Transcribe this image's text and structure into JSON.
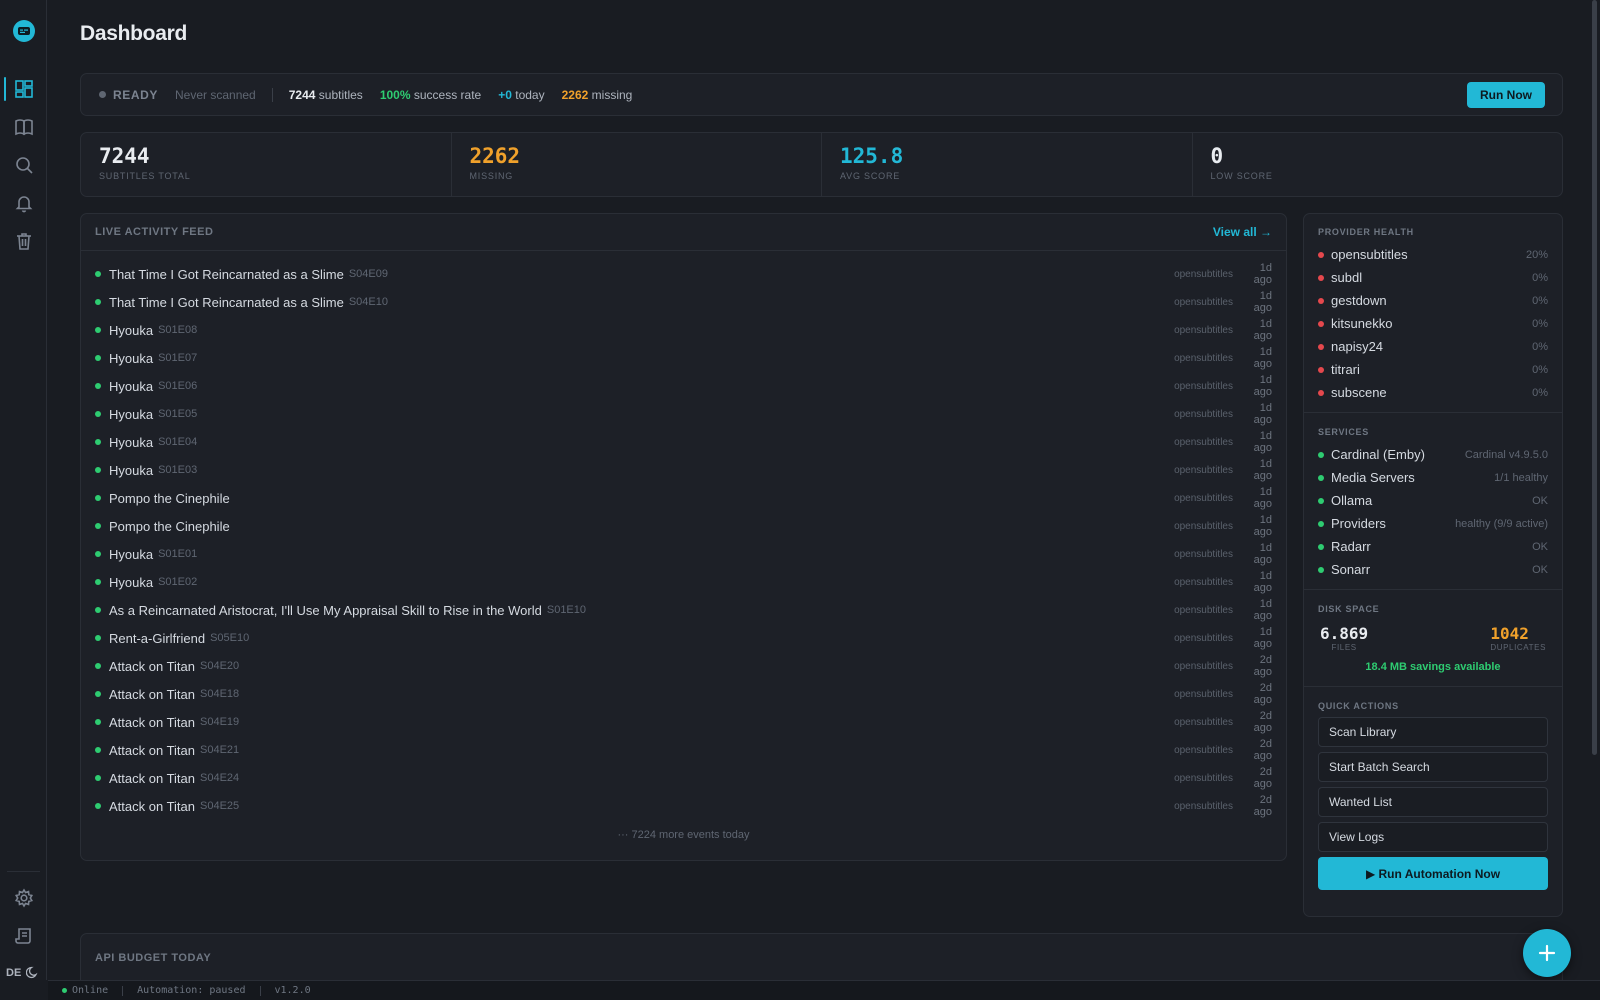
{
  "page": {
    "title": "Dashboard"
  },
  "colors": {
    "accent": "#22b8d6",
    "success": "#2ecc71",
    "warning": "#f0a12b",
    "danger": "#e5484d"
  },
  "sidebar": {
    "items": [
      {
        "icon": "dashboard-icon",
        "active": true
      },
      {
        "icon": "library-icon"
      },
      {
        "icon": "search-icon"
      },
      {
        "icon": "bell-icon"
      },
      {
        "icon": "trash-icon"
      }
    ],
    "bottom": [
      {
        "icon": "gear-icon"
      },
      {
        "icon": "logs-icon"
      }
    ],
    "language": "DE",
    "theme_icon": "moon-icon"
  },
  "status": {
    "state": "READY",
    "last_scan": "Never scanned",
    "subtitles_count": "7244",
    "subtitles_label": "subtitles",
    "success_rate": "100%",
    "success_label": "success rate",
    "today_count": "+0",
    "today_label": "today",
    "missing_count": "2262",
    "missing_label": "missing",
    "run_label": "Run Now"
  },
  "stats": [
    {
      "value": "7244",
      "label": "Subtitles Total"
    },
    {
      "value": "2262",
      "label": "Missing"
    },
    {
      "value": "125.8",
      "label": "Avg Score"
    },
    {
      "value": "0",
      "label": "Low Score"
    }
  ],
  "feed": {
    "title": "LIVE ACTIVITY FEED",
    "view_all": "View all →",
    "items": [
      {
        "title": "That Time I Got Reincarnated as a Slime",
        "ep": "S04E09",
        "source": "opensubtitles",
        "time": "1d ago"
      },
      {
        "title": "That Time I Got Reincarnated as a Slime",
        "ep": "S04E10",
        "source": "opensubtitles",
        "time": "1d ago"
      },
      {
        "title": "Hyouka",
        "ep": "S01E08",
        "source": "opensubtitles",
        "time": "1d ago"
      },
      {
        "title": "Hyouka",
        "ep": "S01E07",
        "source": "opensubtitles",
        "time": "1d ago"
      },
      {
        "title": "Hyouka",
        "ep": "S01E06",
        "source": "opensubtitles",
        "time": "1d ago"
      },
      {
        "title": "Hyouka",
        "ep": "S01E05",
        "source": "opensubtitles",
        "time": "1d ago"
      },
      {
        "title": "Hyouka",
        "ep": "S01E04",
        "source": "opensubtitles",
        "time": "1d ago"
      },
      {
        "title": "Hyouka",
        "ep": "S01E03",
        "source": "opensubtitles",
        "time": "1d ago"
      },
      {
        "title": "Pompo the Cinephile",
        "ep": "",
        "source": "opensubtitles",
        "time": "1d ago"
      },
      {
        "title": "Pompo the Cinephile",
        "ep": "",
        "source": "opensubtitles",
        "time": "1d ago"
      },
      {
        "title": "Hyouka",
        "ep": "S01E01",
        "source": "opensubtitles",
        "time": "1d ago"
      },
      {
        "title": "Hyouka",
        "ep": "S01E02",
        "source": "opensubtitles",
        "time": "1d ago"
      },
      {
        "title": "As a Reincarnated Aristocrat, I'll Use My Appraisal Skill to Rise in the World",
        "ep": "S01E10",
        "source": "opensubtitles",
        "time": "1d ago"
      },
      {
        "title": "Rent-a-Girlfriend",
        "ep": "S05E10",
        "source": "opensubtitles",
        "time": "1d ago"
      },
      {
        "title": "Attack on Titan",
        "ep": "S04E20",
        "source": "opensubtitles",
        "time": "2d ago"
      },
      {
        "title": "Attack on Titan",
        "ep": "S04E18",
        "source": "opensubtitles",
        "time": "2d ago"
      },
      {
        "title": "Attack on Titan",
        "ep": "S04E19",
        "source": "opensubtitles",
        "time": "2d ago"
      },
      {
        "title": "Attack on Titan",
        "ep": "S04E21",
        "source": "opensubtitles",
        "time": "2d ago"
      },
      {
        "title": "Attack on Titan",
        "ep": "S04E24",
        "source": "opensubtitles",
        "time": "2d ago"
      },
      {
        "title": "Attack on Titan",
        "ep": "S04E25",
        "source": "opensubtitles",
        "time": "2d ago"
      }
    ],
    "more": "··· 7224 more events today"
  },
  "provider_health": {
    "title": "PROVIDER HEALTH",
    "items": [
      {
        "name": "opensubtitles",
        "value": "20%"
      },
      {
        "name": "subdl",
        "value": "0%"
      },
      {
        "name": "gestdown",
        "value": "0%"
      },
      {
        "name": "kitsunekko",
        "value": "0%"
      },
      {
        "name": "napisy24",
        "value": "0%"
      },
      {
        "name": "titrari",
        "value": "0%"
      },
      {
        "name": "subscene",
        "value": "0%"
      }
    ]
  },
  "services": {
    "title": "SERVICES",
    "items": [
      {
        "name": "Cardinal (Emby)",
        "value": "Cardinal v4.9.5.0"
      },
      {
        "name": "Media Servers",
        "value": "1/1 healthy"
      },
      {
        "name": "Ollama",
        "value": "OK"
      },
      {
        "name": "Providers",
        "value": "healthy (9/9 active)"
      },
      {
        "name": "Radarr",
        "value": "OK"
      },
      {
        "name": "Sonarr",
        "value": "OK"
      }
    ]
  },
  "disk": {
    "title": "DISK SPACE",
    "files_value": "6.869",
    "files_label": "FILES",
    "dup_value": "1042",
    "dup_label": "DUPLICATES",
    "savings": "18.4 MB savings available"
  },
  "quick_actions": {
    "title": "QUICK ACTIONS",
    "buttons": [
      "Scan Library",
      "Start Batch Search",
      "Wanted List",
      "View Logs"
    ],
    "primary": "▶ Run Automation Now"
  },
  "api_budget": {
    "title": "API BUDGET TODAY"
  },
  "footer": {
    "online": "Online",
    "automation": "Automation: paused",
    "version": "v1.2.0"
  }
}
